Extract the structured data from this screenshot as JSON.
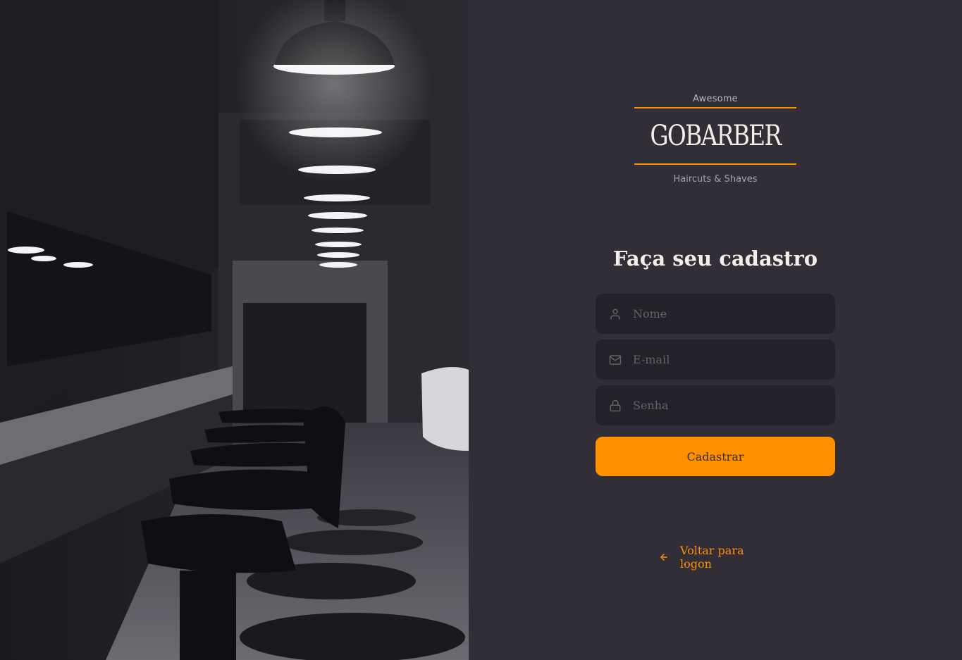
{
  "logo": {
    "top_text": "Awesome",
    "brand": "GOBARBER",
    "bottom_text": "Haircuts & Shaves"
  },
  "form": {
    "title": "Faça seu cadastro",
    "name_placeholder": "Nome",
    "email_placeholder": "E-mail",
    "password_placeholder": "Senha",
    "submit_label": "Cadastrar"
  },
  "back_link": {
    "label": "Voltar para logon",
    "icon": "arrow-left-icon"
  },
  "icons": {
    "name": "user-icon",
    "email": "mail-icon",
    "password": "lock-icon"
  },
  "colors": {
    "background": "#312e38",
    "input_background": "#232129",
    "accent": "#ff9000",
    "text": "#f4ede8",
    "placeholder": "#666360"
  }
}
